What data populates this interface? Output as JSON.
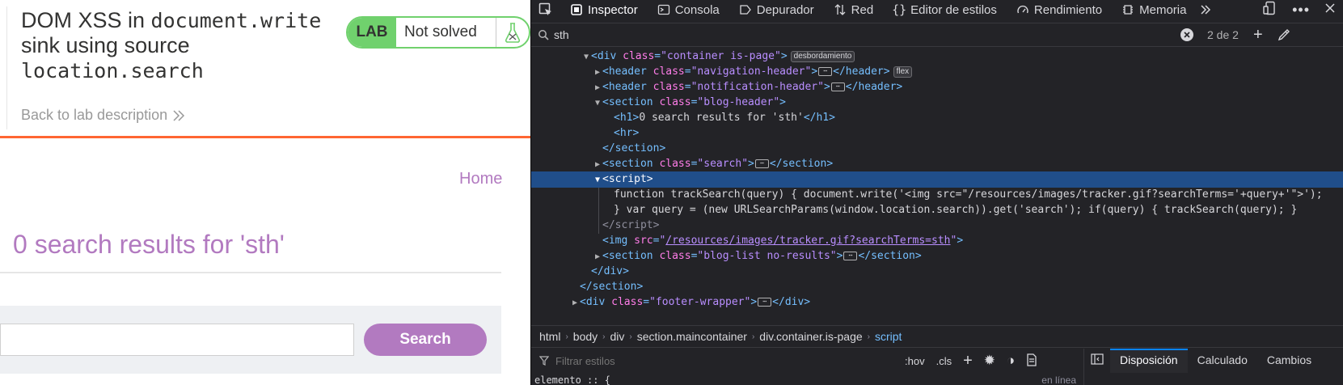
{
  "lab": {
    "title_parts": [
      "DOM XSS in ",
      "document.write",
      " sink using source ",
      "location.search"
    ],
    "badge_label": "LAB",
    "status": "Not solved",
    "back_link": "Back to lab description",
    "home_link": "Home",
    "results_heading": "0 search results for 'sth'",
    "search_placeholder": "",
    "search_button": "Search",
    "colors": {
      "accent": "#b27ac0",
      "badge_green": "#70d16d",
      "rule_orange": "#ff6633"
    }
  },
  "devtools": {
    "tabs": [
      {
        "label": "Inspector",
        "icon": "inspector-icon",
        "active": true
      },
      {
        "label": "Consola",
        "icon": "console-icon"
      },
      {
        "label": "Depurador",
        "icon": "debugger-icon"
      },
      {
        "label": "Red",
        "icon": "network-icon"
      },
      {
        "label": "Editor de estilos",
        "icon": "style-editor-icon"
      },
      {
        "label": "Rendimiento",
        "icon": "performance-icon"
      },
      {
        "label": "Memoria",
        "icon": "memory-icon"
      }
    ],
    "search": {
      "value": "sth",
      "count": "2 de 2"
    },
    "markup": {
      "container_badge": "desbordamiento",
      "flex_badge": "flex",
      "ellipsis": "⋯",
      "h1_text": "0 search results for 'sth'",
      "script_line1": "function trackSearch(query) { document.write('<img src=\"/resources/images/tracker.gif?searchTerms='+query+'\">'); ",
      "script_line2": "} var query = (new URLSearchParams(window.location.search)).get('search'); if(query) { trackSearch(query); }",
      "img_src": "/resources/images/tracker.gif?searchTerms=sth"
    },
    "breadcrumbs": [
      "html",
      "body",
      "div",
      "section.maincontainer",
      "div.container.is-page",
      "script"
    ],
    "filter": {
      "placeholder": "Filtrar estilos",
      "hov": ":hov",
      "cls": ".cls"
    },
    "rule_preview": {
      "selector": "elemento :: {",
      "source": "en línea"
    },
    "side_tabs": [
      "Disposición",
      "Calculado",
      "Cambios"
    ]
  }
}
